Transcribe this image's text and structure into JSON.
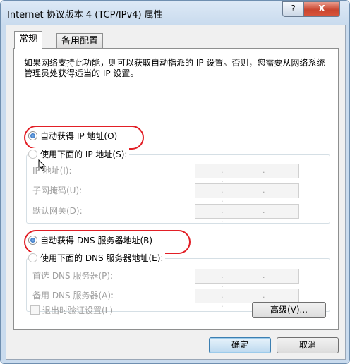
{
  "window": {
    "title": "Internet 协议版本 4 (TCP/IPv4) 属性",
    "help_label": "?",
    "close_label": "X"
  },
  "tabs": [
    {
      "label": "常规",
      "selected": true
    },
    {
      "label": "备用配置",
      "selected": false
    }
  ],
  "description": "如果网络支持此功能，则可以获取自动指派的 IP 设置。否则，您需要从网络系统管理员处获得适当的 IP 设置。",
  "ip_section": {
    "auto_label": "自动获得 IP 地址(O)",
    "manual_label": "使用下面的 IP 地址(S):",
    "auto_selected": true,
    "fields": [
      {
        "label": "IP 地址(I):",
        "value": ". . ."
      },
      {
        "label": "子网掩码(U):",
        "value": ". . ."
      },
      {
        "label": "默认网关(D):",
        "value": ". . ."
      }
    ]
  },
  "dns_section": {
    "auto_label": "自动获得 DNS 服务器地址(B)",
    "manual_label": "使用下面的 DNS 服务器地址(E):",
    "auto_selected": true,
    "fields": [
      {
        "label": "首选 DNS 服务器(P):",
        "value": ". . ."
      },
      {
        "label": "备用 DNS 服务器(A):",
        "value": ". . ."
      }
    ]
  },
  "validate_label": "退出时验证设置(L)",
  "advanced_label": "高级(V)...",
  "ok_label": "确定",
  "cancel_label": "取消",
  "colors": {
    "highlight": "#e21f26",
    "disabled_text": "#a0a0a0"
  }
}
